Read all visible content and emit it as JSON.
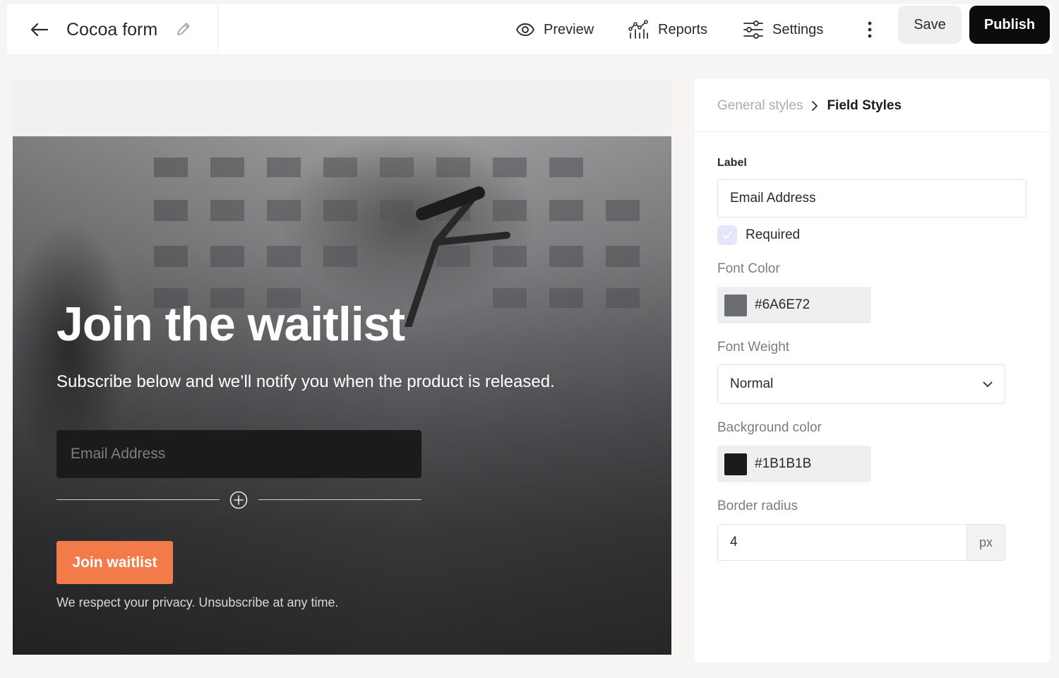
{
  "header": {
    "form_title": "Cocoa form",
    "nav": {
      "preview": "Preview",
      "reports": "Reports",
      "settings": "Settings"
    },
    "save_label": "Save",
    "publish_label": "Publish"
  },
  "preview": {
    "title": "Join the waitlist",
    "subtitle": "Subscribe below and we’ll notify you when the product is released.",
    "email_placeholder": "Email Address",
    "join_label": "Join waitlist",
    "privacy_text": "We respect your privacy. Unsubscribe at any time.",
    "button_color": "#F37A49"
  },
  "panel": {
    "breadcrumb": {
      "parent": "General styles",
      "current": "Field Styles"
    },
    "label_heading": "Label",
    "label_value": "Email Address",
    "required_label": "Required",
    "required_checked": true,
    "font_color_label": "Font Color",
    "font_color_value": "#6A6E72",
    "font_weight_label": "Font Weight",
    "font_weight_value": "Normal",
    "background_color_label": "Background color",
    "background_color_value": "#1B1B1B",
    "border_radius_label": "Border radius",
    "border_radius_value": "4",
    "border_radius_unit": "px"
  },
  "icons": {
    "back": "arrow-left-icon",
    "edit": "pencil-icon",
    "preview": "eye-icon",
    "reports": "chart-icon",
    "settings": "sliders-icon",
    "more": "more-vertical-icon",
    "add": "plus-circle-icon",
    "breadcrumb_sep": "chevron-right-icon",
    "select": "chevron-down-icon",
    "check": "check-icon"
  }
}
